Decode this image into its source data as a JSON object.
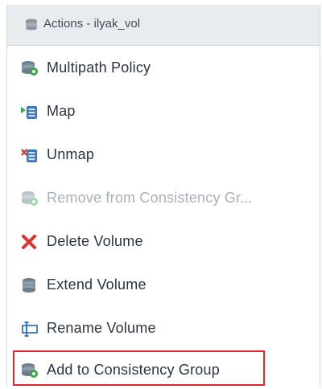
{
  "header": {
    "title": "Actions - ilyak_vol",
    "icon": "volume-stack-icon"
  },
  "items": [
    {
      "label": "Multipath Policy",
      "icon": "volume-gear-icon",
      "enabled": true
    },
    {
      "label": "Map",
      "icon": "map-volume-icon",
      "enabled": true
    },
    {
      "label": "Unmap",
      "icon": "unmap-volume-icon",
      "enabled": true
    },
    {
      "label": "Remove from Consistency Gr...",
      "icon": "volume-gear-icon",
      "enabled": false
    },
    {
      "label": "Delete Volume",
      "icon": "red-x-icon",
      "enabled": true
    },
    {
      "label": "Extend Volume",
      "icon": "volume-stack-icon",
      "enabled": true
    },
    {
      "label": "Rename Volume",
      "icon": "rename-icon",
      "enabled": true
    },
    {
      "label": "Add to Consistency Group",
      "icon": "volume-gear-icon",
      "enabled": true,
      "highlighted": true
    }
  ],
  "colors": {
    "highlight_border": "#e0282c",
    "accent_green": "#39a845",
    "accent_blue": "#3b78b5",
    "delete_red": "#d8322e"
  }
}
